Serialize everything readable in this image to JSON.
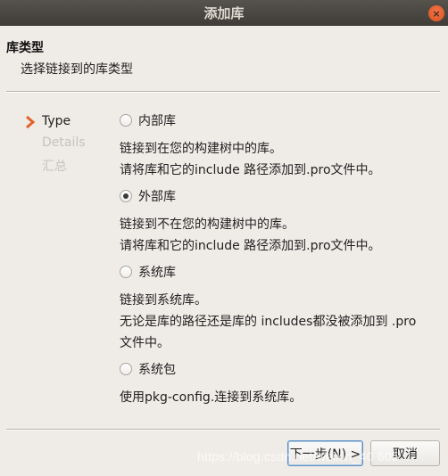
{
  "window": {
    "title": "添加库",
    "close_icon": "×"
  },
  "header": {
    "title": "库类型",
    "subtitle": "选择链接到的库类型"
  },
  "steps": [
    {
      "label": "Type",
      "state": "current"
    },
    {
      "label": "Details",
      "state": "pending"
    },
    {
      "label": "汇总",
      "state": "pending"
    }
  ],
  "options": [
    {
      "label": "内部库",
      "checked": false,
      "description": [
        "链接到在您的构建树中的库。",
        "请将库和它的include 路径添加到.pro文件中。"
      ]
    },
    {
      "label": "外部库",
      "checked": true,
      "description": [
        "链接到不在您的构建树中的库。",
        "请将库和它的include 路径添加到.pro文件中。"
      ]
    },
    {
      "label": "系统库",
      "checked": false,
      "description": [
        "链接到系统库。",
        "无论是库的路径还是库的 includes都没被添加到 .pro",
        "文件中。"
      ]
    },
    {
      "label": "系统包",
      "checked": false,
      "description": [
        "使用pkg-config.连接到系统库。"
      ]
    }
  ],
  "buttons": {
    "next_label": "下一步(N) >",
    "cancel_label": "取消"
  },
  "watermark": "https://blog.csdn.net/weixin_40   605",
  "colors": {
    "accent_chevron": "#e2622a",
    "default_button_border": "#5b8ec2",
    "close_button": "#e45b2a"
  }
}
